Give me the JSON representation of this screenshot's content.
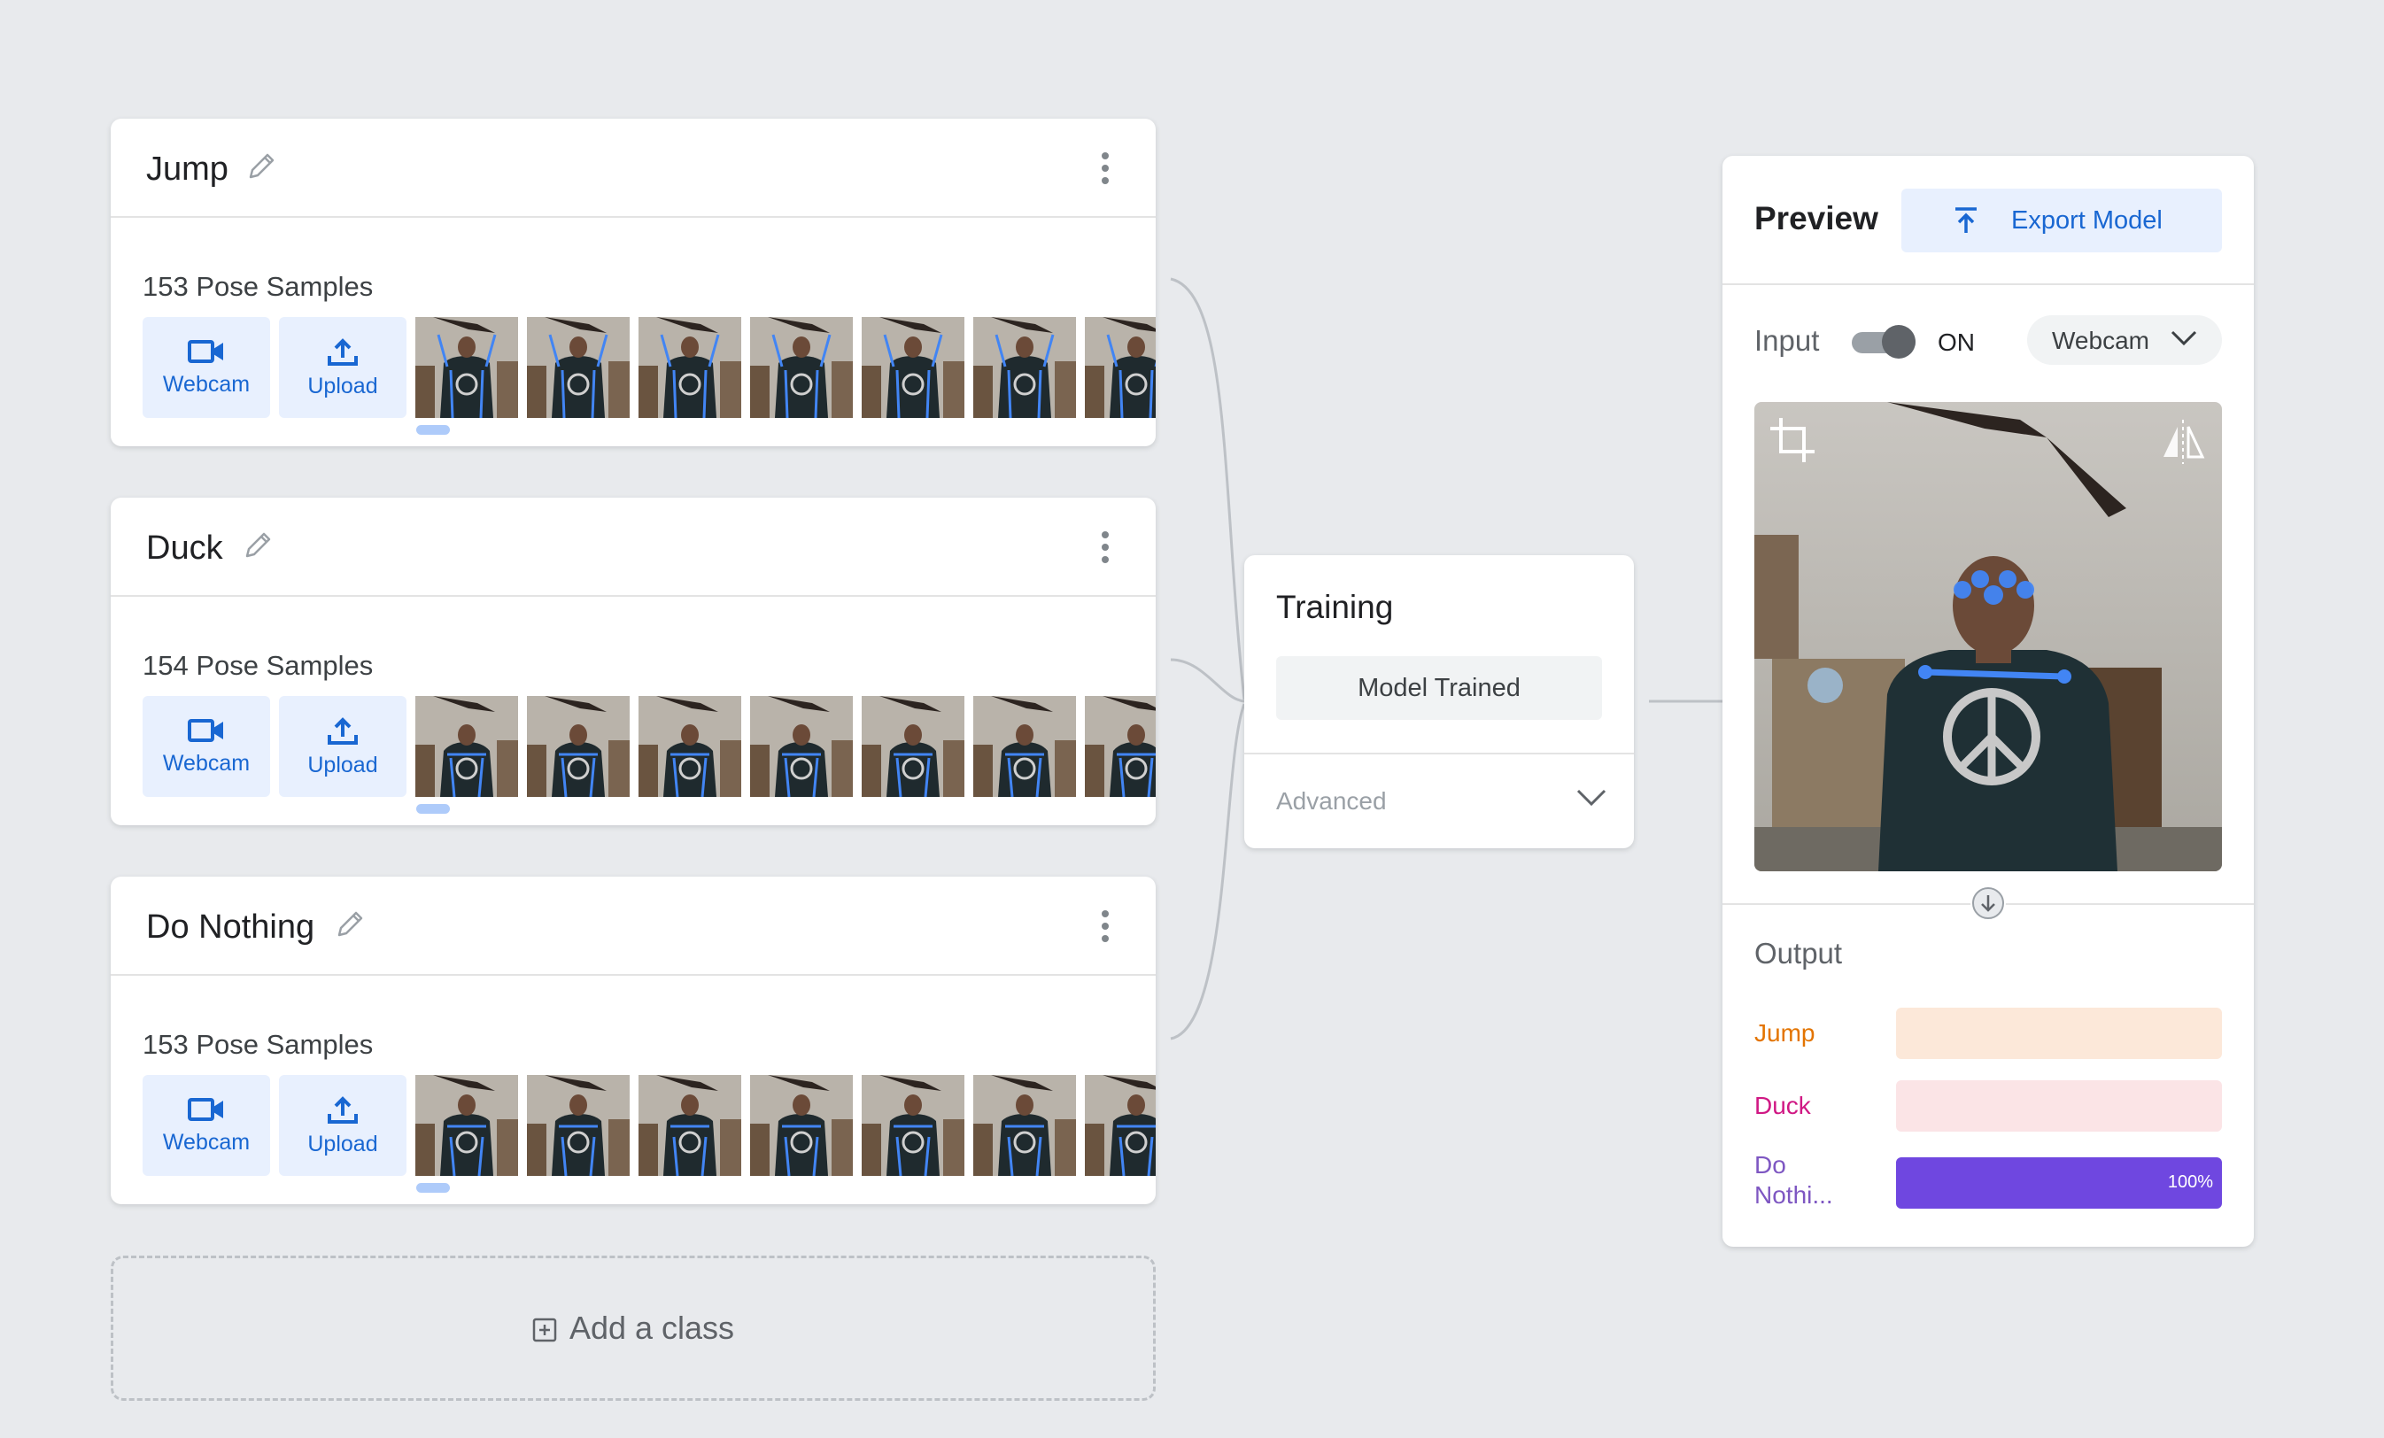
{
  "classes": [
    {
      "title": "Jump",
      "samples": "153 Pose Samples",
      "webcam_label": "Webcam",
      "upload_label": "Upload"
    },
    {
      "title": "Duck",
      "samples": "154 Pose Samples",
      "webcam_label": "Webcam",
      "upload_label": "Upload"
    },
    {
      "title": "Do Nothing",
      "samples": "153 Pose Samples",
      "webcam_label": "Webcam",
      "upload_label": "Upload"
    }
  ],
  "add_class": {
    "label": "Add a class"
  },
  "training": {
    "title": "Training",
    "status": "Model Trained",
    "advanced_label": "Advanced"
  },
  "preview": {
    "title": "Preview",
    "export_label": "Export Model",
    "input_label": "Input",
    "toggle_state": "ON",
    "source": "Webcam",
    "output_label": "Output",
    "outputs": [
      {
        "label": "Jump",
        "value": 0,
        "percent_text": "",
        "color": "#e37400",
        "bar_bg": "#fce8d9",
        "fill": "#e37400"
      },
      {
        "label": "Duck",
        "value": 0,
        "percent_text": "",
        "color": "#d01884",
        "bar_bg": "#fbe4e6",
        "fill": "#d01884"
      },
      {
        "label": "Do Nothi...",
        "value": 1.0,
        "percent_text": "100%",
        "color": "#7e57c2",
        "bar_bg": "#ede7f6",
        "fill": "#6f47e0"
      }
    ]
  },
  "colors": {
    "background": "#e8eaed",
    "accent_blue": "#1967d2",
    "tile_blue": "#e8f0fe",
    "pose_blue": "#4285f4"
  }
}
